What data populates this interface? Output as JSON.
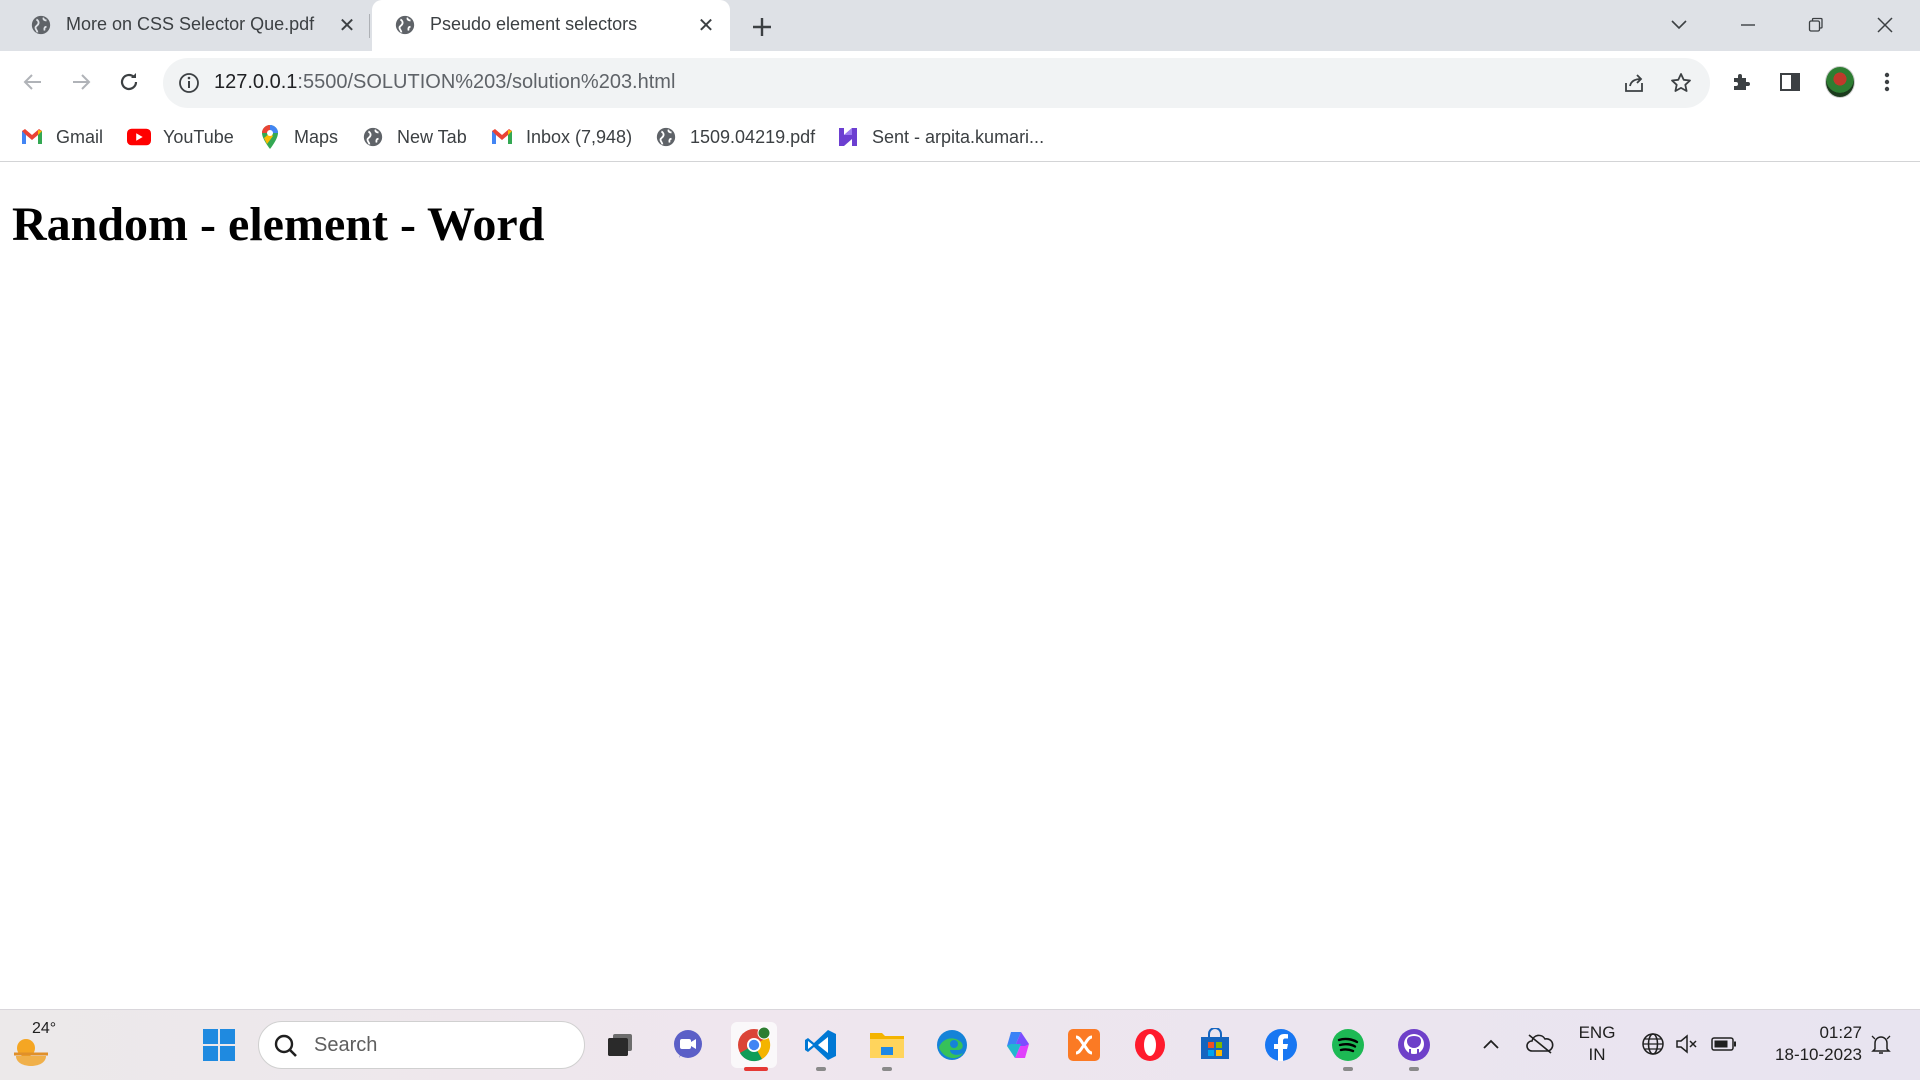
{
  "browser": {
    "tabs": [
      {
        "title": "More on CSS Selector Que.pdf",
        "active": false
      },
      {
        "title": "Pseudo element selectors",
        "active": true
      }
    ],
    "address": {
      "host": "127.0.0.1",
      "path": ":5500/SOLUTION%203/solution%203.html"
    },
    "bookmarks": [
      {
        "label": "Gmail",
        "icon": "gmail-icon"
      },
      {
        "label": "YouTube",
        "icon": "youtube-icon"
      },
      {
        "label": "Maps",
        "icon": "maps-icon"
      },
      {
        "label": "New Tab",
        "icon": "globe-icon"
      },
      {
        "label": "Inbox (7,948)",
        "icon": "gmail-icon"
      },
      {
        "label": "1509.04219.pdf",
        "icon": "globe-icon"
      },
      {
        "label": "Sent - arpita.kumari...",
        "icon": "mail-app-icon"
      }
    ]
  },
  "page": {
    "heading": "Random - element - Word"
  },
  "taskbar": {
    "weather_temp": "24°",
    "search_placeholder": "Search",
    "apps": [
      "windows-start",
      "task-view",
      "meet",
      "chrome",
      "vscode",
      "file-explorer",
      "edge",
      "copilot",
      "xampp",
      "opera",
      "microsoft-store",
      "facebook",
      "spotify",
      "github-desktop"
    ],
    "active_app": "chrome",
    "lang_line1": "ENG",
    "lang_line2": "IN",
    "time": "01:27",
    "date": "18-10-2023"
  },
  "colors": {
    "tabstrip": "#dee1e6",
    "omnibox": "#f1f3f4",
    "youtube_red": "#ff0000",
    "chrome_active_indicator": "#e53935"
  }
}
